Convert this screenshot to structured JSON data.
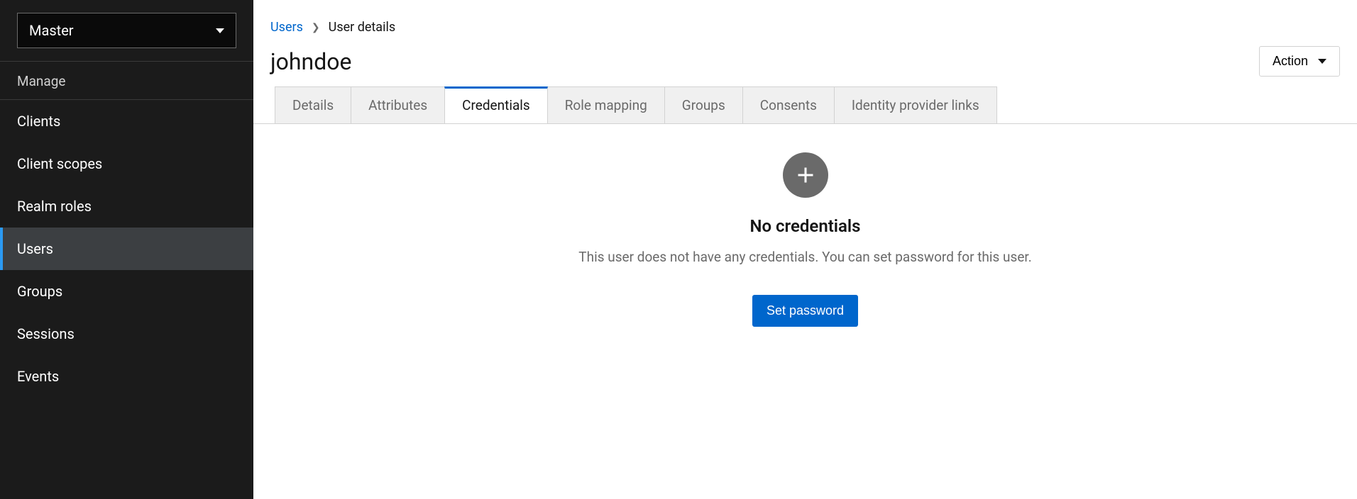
{
  "sidebar": {
    "realm": "Master",
    "section": "Manage",
    "items": [
      {
        "label": "Clients",
        "active": false
      },
      {
        "label": "Client scopes",
        "active": false
      },
      {
        "label": "Realm roles",
        "active": false
      },
      {
        "label": "Users",
        "active": true
      },
      {
        "label": "Groups",
        "active": false
      },
      {
        "label": "Sessions",
        "active": false
      },
      {
        "label": "Events",
        "active": false
      }
    ]
  },
  "breadcrumb": {
    "parent": "Users",
    "current": "User details"
  },
  "header": {
    "title": "johndoe",
    "action": "Action"
  },
  "tabs": [
    {
      "label": "Details",
      "active": false
    },
    {
      "label": "Attributes",
      "active": false
    },
    {
      "label": "Credentials",
      "active": true
    },
    {
      "label": "Role mapping",
      "active": false
    },
    {
      "label": "Groups",
      "active": false
    },
    {
      "label": "Consents",
      "active": false
    },
    {
      "label": "Identity provider links",
      "active": false
    }
  ],
  "empty_state": {
    "title": "No credentials",
    "description": "This user does not have any credentials. You can set password for this user.",
    "button": "Set password"
  }
}
